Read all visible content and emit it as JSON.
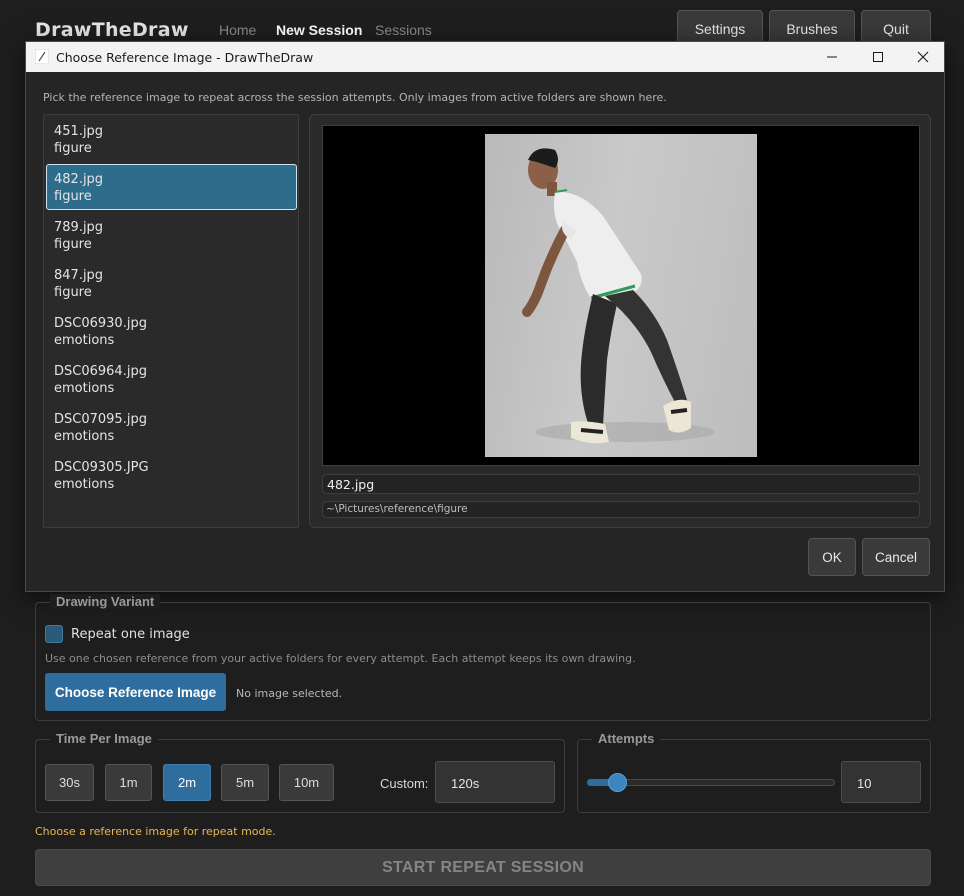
{
  "app": {
    "title": "DrawTheDraw",
    "nav": [
      "Home",
      "New Session",
      "Sessions"
    ],
    "active_nav": "New Session",
    "top_buttons": [
      "Settings",
      "Brushes",
      "Quit"
    ]
  },
  "dialog": {
    "title": "Choose Reference Image - DrawTheDraw",
    "description": "Pick the reference image to repeat across the session attempts. Only images from active folders are shown here.",
    "files": [
      {
        "name": "451.jpg",
        "folder": "figure"
      },
      {
        "name": "482.jpg",
        "folder": "figure"
      },
      {
        "name": "789.jpg",
        "folder": "figure"
      },
      {
        "name": "847.jpg",
        "folder": "figure"
      },
      {
        "name": "DSC06930.jpg",
        "folder": "emotions"
      },
      {
        "name": "DSC06964.jpg",
        "folder": "emotions"
      },
      {
        "name": "DSC07095.jpg",
        "folder": "emotions"
      },
      {
        "name": "DSC09305.JPG",
        "folder": "emotions"
      }
    ],
    "selected_index": 1,
    "preview_name": "482.jpg",
    "preview_path": "~\\Pictures\\reference\\figure",
    "ok_label": "OK",
    "cancel_label": "Cancel"
  },
  "variant": {
    "title": "Drawing Variant",
    "checkbox_label": "Repeat one image",
    "checked": false,
    "description": "Use one chosen reference from your active folders for every attempt. Each attempt keeps its own drawing.",
    "choose_label": "Choose Reference Image",
    "status": "No image selected."
  },
  "time": {
    "title": "Time Per Image",
    "options": [
      "30s",
      "1m",
      "2m",
      "5m",
      "10m"
    ],
    "selected": "2m",
    "custom_label": "Custom:",
    "custom_value": "120s"
  },
  "attempts": {
    "title": "Attempts",
    "value": "10",
    "slider_fraction": 0.13
  },
  "footer": {
    "warning": "Choose a reference image for repeat mode.",
    "start_label": "START REPEAT SESSION"
  },
  "colors": {
    "accent": "#2e6e9e",
    "warning": "#e7b752",
    "background": "#1e1e1e"
  }
}
